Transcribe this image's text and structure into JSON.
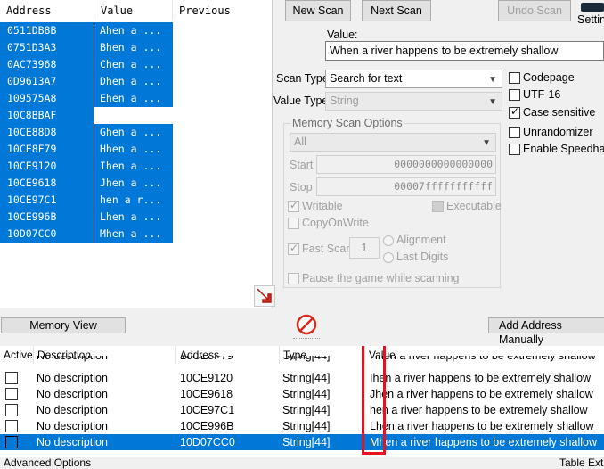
{
  "found_list": {
    "headers": {
      "address": "Address",
      "value": "Value",
      "previous": "Previous"
    },
    "rows": [
      {
        "address": "0511DB8B",
        "value": "Ahen a ..."
      },
      {
        "address": "0751D3A3",
        "value": "Bhen a ..."
      },
      {
        "address": "0AC73968",
        "value": "Chen a ..."
      },
      {
        "address": "0D9613A7",
        "value": "Dhen a ..."
      },
      {
        "address": "109575A8",
        "value": "Ehen a ..."
      },
      {
        "address": "10C8BBAF",
        "value": ""
      },
      {
        "address": "10CE88D8",
        "value": "Ghen a ..."
      },
      {
        "address": "10CE8F79",
        "value": "Hhen a ..."
      },
      {
        "address": "10CE9120",
        "value": "Ihen a ..."
      },
      {
        "address": "10CE9618",
        "value": "Jhen a ..."
      },
      {
        "address": "10CE97C1",
        "value": "hen a r..."
      },
      {
        "address": "10CE996B",
        "value": "Lhen a ..."
      },
      {
        "address": "10D07CC0",
        "value": "Mhen a ..."
      }
    ]
  },
  "toolbar": {
    "new_scan": "New Scan",
    "next_scan": "Next Scan",
    "undo_scan": "Undo Scan",
    "settings": "Settin"
  },
  "scan": {
    "value_label": "Value:",
    "value_text": "When a river happens to be extremely shallow",
    "scan_type_label": "Scan Type",
    "scan_type_value": "Search for text",
    "value_type_label": "Value Type",
    "value_type_value": "String"
  },
  "memory_options": {
    "title": "Memory Scan Options",
    "region": "All",
    "start_label": "Start",
    "start_value": "0000000000000000",
    "stop_label": "Stop",
    "stop_value": "00007fffffffffff",
    "writable": "Writable",
    "executable": "Executable",
    "copy_on_write": "CopyOnWrite",
    "fast_scan": "Fast Scan",
    "fast_scan_value": "1",
    "alignment": "Alignment",
    "last_digits": "Last Digits",
    "pause_game": "Pause the game while scanning"
  },
  "side_options": {
    "codepage": "Codepage",
    "utf16": "UTF-16",
    "case_sensitive": "Case sensitive",
    "unrandomizer": "Unrandomizer",
    "speedhack": "Enable Speedhack"
  },
  "bottom_bar": {
    "memory_view": "Memory View",
    "add_address": "Add Address Manually"
  },
  "table": {
    "headers": {
      "active": "Active",
      "description": "Description",
      "address": "Address",
      "type": "Type",
      "value": "Value"
    },
    "rows": [
      {
        "description": "No description",
        "address": "10CE8F79",
        "type": "String[44]",
        "value": "Hhen a river happens to be extremely shallow"
      },
      {
        "description": "No description",
        "address": "10CE9120",
        "type": "String[44]",
        "value": "Ihen a river happens to be extremely shallow"
      },
      {
        "description": "No description",
        "address": "10CE9618",
        "type": "String[44]",
        "value": "Jhen a river happens to be extremely shallow"
      },
      {
        "description": "No description",
        "address": "10CE97C1",
        "type": "String[44]",
        "value": "hen a river happens to be extremely shallow"
      },
      {
        "description": "No description",
        "address": "10CE996B",
        "type": "String[44]",
        "value": "Lhen a river happens to be extremely shallow"
      },
      {
        "description": "No description",
        "address": "10D07CC0",
        "type": "String[44]",
        "value": "Mhen a river happens to be extremely shallow"
      }
    ]
  },
  "footer": {
    "advanced": "Advanced Options",
    "table_extras": "Table Extras"
  },
  "colors": {
    "selection": "#0078d7",
    "highlight_box": "#e81123"
  },
  "icons": [
    "arrow-icon",
    "stop-icon",
    "logo-icon"
  ]
}
